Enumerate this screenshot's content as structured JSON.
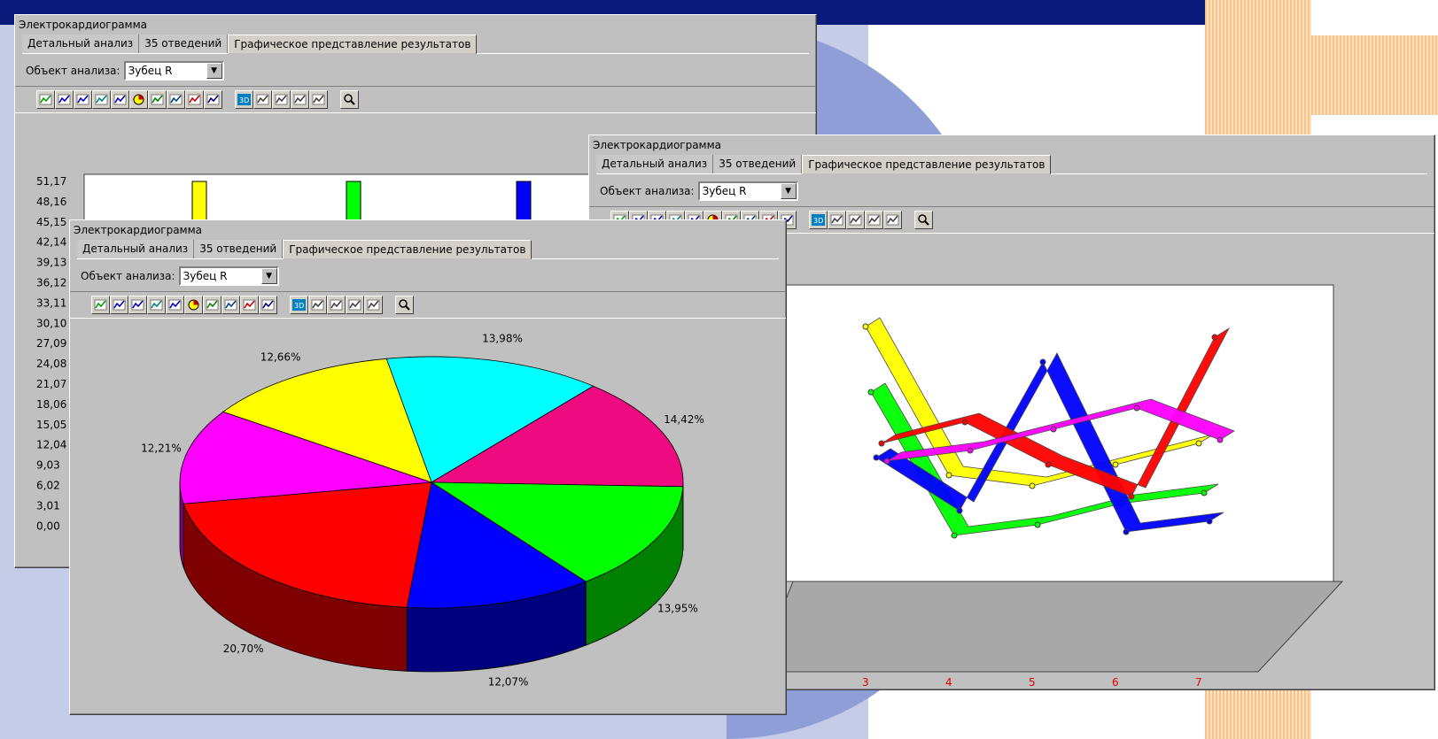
{
  "background": {
    "band_color": "#0a1a7a",
    "accent_orange": "#f7c38a",
    "panel_blue": "#c4cce8"
  },
  "windows": {
    "bar": {
      "title": "Электрокардиограмма",
      "tabs": [
        "Детальный анализ",
        "35 отведений",
        "Графическое представление результатов"
      ],
      "object_label": "Объект анализа:",
      "object_value": "Зубец R",
      "yticks": [
        "51,17",
        "48,16",
        "45,15",
        "42,14",
        "39,13",
        "36,12",
        "33,11",
        "30,10",
        "27,09",
        "24,08",
        "21,07",
        "18,06",
        "15,05",
        "12,04",
        "9,03",
        "6,02",
        "3,01",
        "0,00"
      ]
    },
    "line": {
      "title": "Электрокардиограмма",
      "tabs": [
        "Детальный анализ",
        "35 отведений",
        "Графическое представление результатов"
      ],
      "object_label": "Объект анализа:",
      "object_value": "Зубец R",
      "xticks": [
        "3",
        "4",
        "5",
        "6",
        "7"
      ]
    },
    "pie": {
      "title": "Электрокардиограмма",
      "tabs": [
        "Детальный анализ",
        "35 отведений",
        "Графическое представление результатов"
      ],
      "object_label": "Объект анализа:",
      "object_value": "Зубец R"
    }
  },
  "toolbar_icons": [
    "area-chart-icon",
    "horizontal-bar-icon",
    "bar-chart-icon",
    "line-chart-icon",
    "scatter-icon",
    "pie-chart-icon",
    "xy-line-icon",
    "area-3d-icon",
    "points-icon",
    "candlestick-icon",
    "3d-toggle-icon",
    "axis-icon",
    "curve-icon",
    "grid-vertical-icon",
    "grid-horizontal-icon",
    "zoom-icon"
  ],
  "chart_data": [
    {
      "type": "pie",
      "title": "",
      "slices": [
        {
          "label": "13,98%",
          "value": 13.98,
          "color": "#00ffff"
        },
        {
          "label": "14,42%",
          "value": 14.42,
          "color": "#ee0a80"
        },
        {
          "label": "13,95%",
          "value": 13.95,
          "color": "#00ff00"
        },
        {
          "label": "12,07%",
          "value": 12.07,
          "color": "#0000ff"
        },
        {
          "label": "20,70%",
          "value": 20.7,
          "color": "#ff0000"
        },
        {
          "label": "12,21%",
          "value": 12.21,
          "color": "#ff00ff"
        },
        {
          "label": "12,66%",
          "value": 12.66,
          "color": "#ffff00"
        }
      ]
    },
    {
      "type": "line",
      "title": "",
      "x": [
        3,
        4,
        5,
        6,
        7
      ],
      "series": [
        {
          "color": "#ffff00",
          "values": [
            48,
            20,
            18,
            22,
            26
          ]
        },
        {
          "color": "#00ff00",
          "values": [
            35,
            8,
            10,
            14,
            16
          ]
        },
        {
          "color": "#0000ff",
          "values": [
            22,
            12,
            40,
            8,
            10
          ]
        },
        {
          "color": "#ff0000",
          "values": [
            24,
            28,
            20,
            14,
            44
          ]
        },
        {
          "color": "#ff00ff",
          "values": [
            20,
            22,
            26,
            30,
            24
          ]
        }
      ]
    },
    {
      "type": "bar",
      "title": "",
      "ylim": [
        0,
        51.17
      ],
      "series": [
        {
          "color": "#ffff00",
          "values": [
            51.17
          ]
        },
        {
          "color": "#00ff00",
          "values": [
            51.17
          ]
        },
        {
          "color": "#0000ff",
          "values": [
            51.17
          ]
        }
      ]
    }
  ]
}
